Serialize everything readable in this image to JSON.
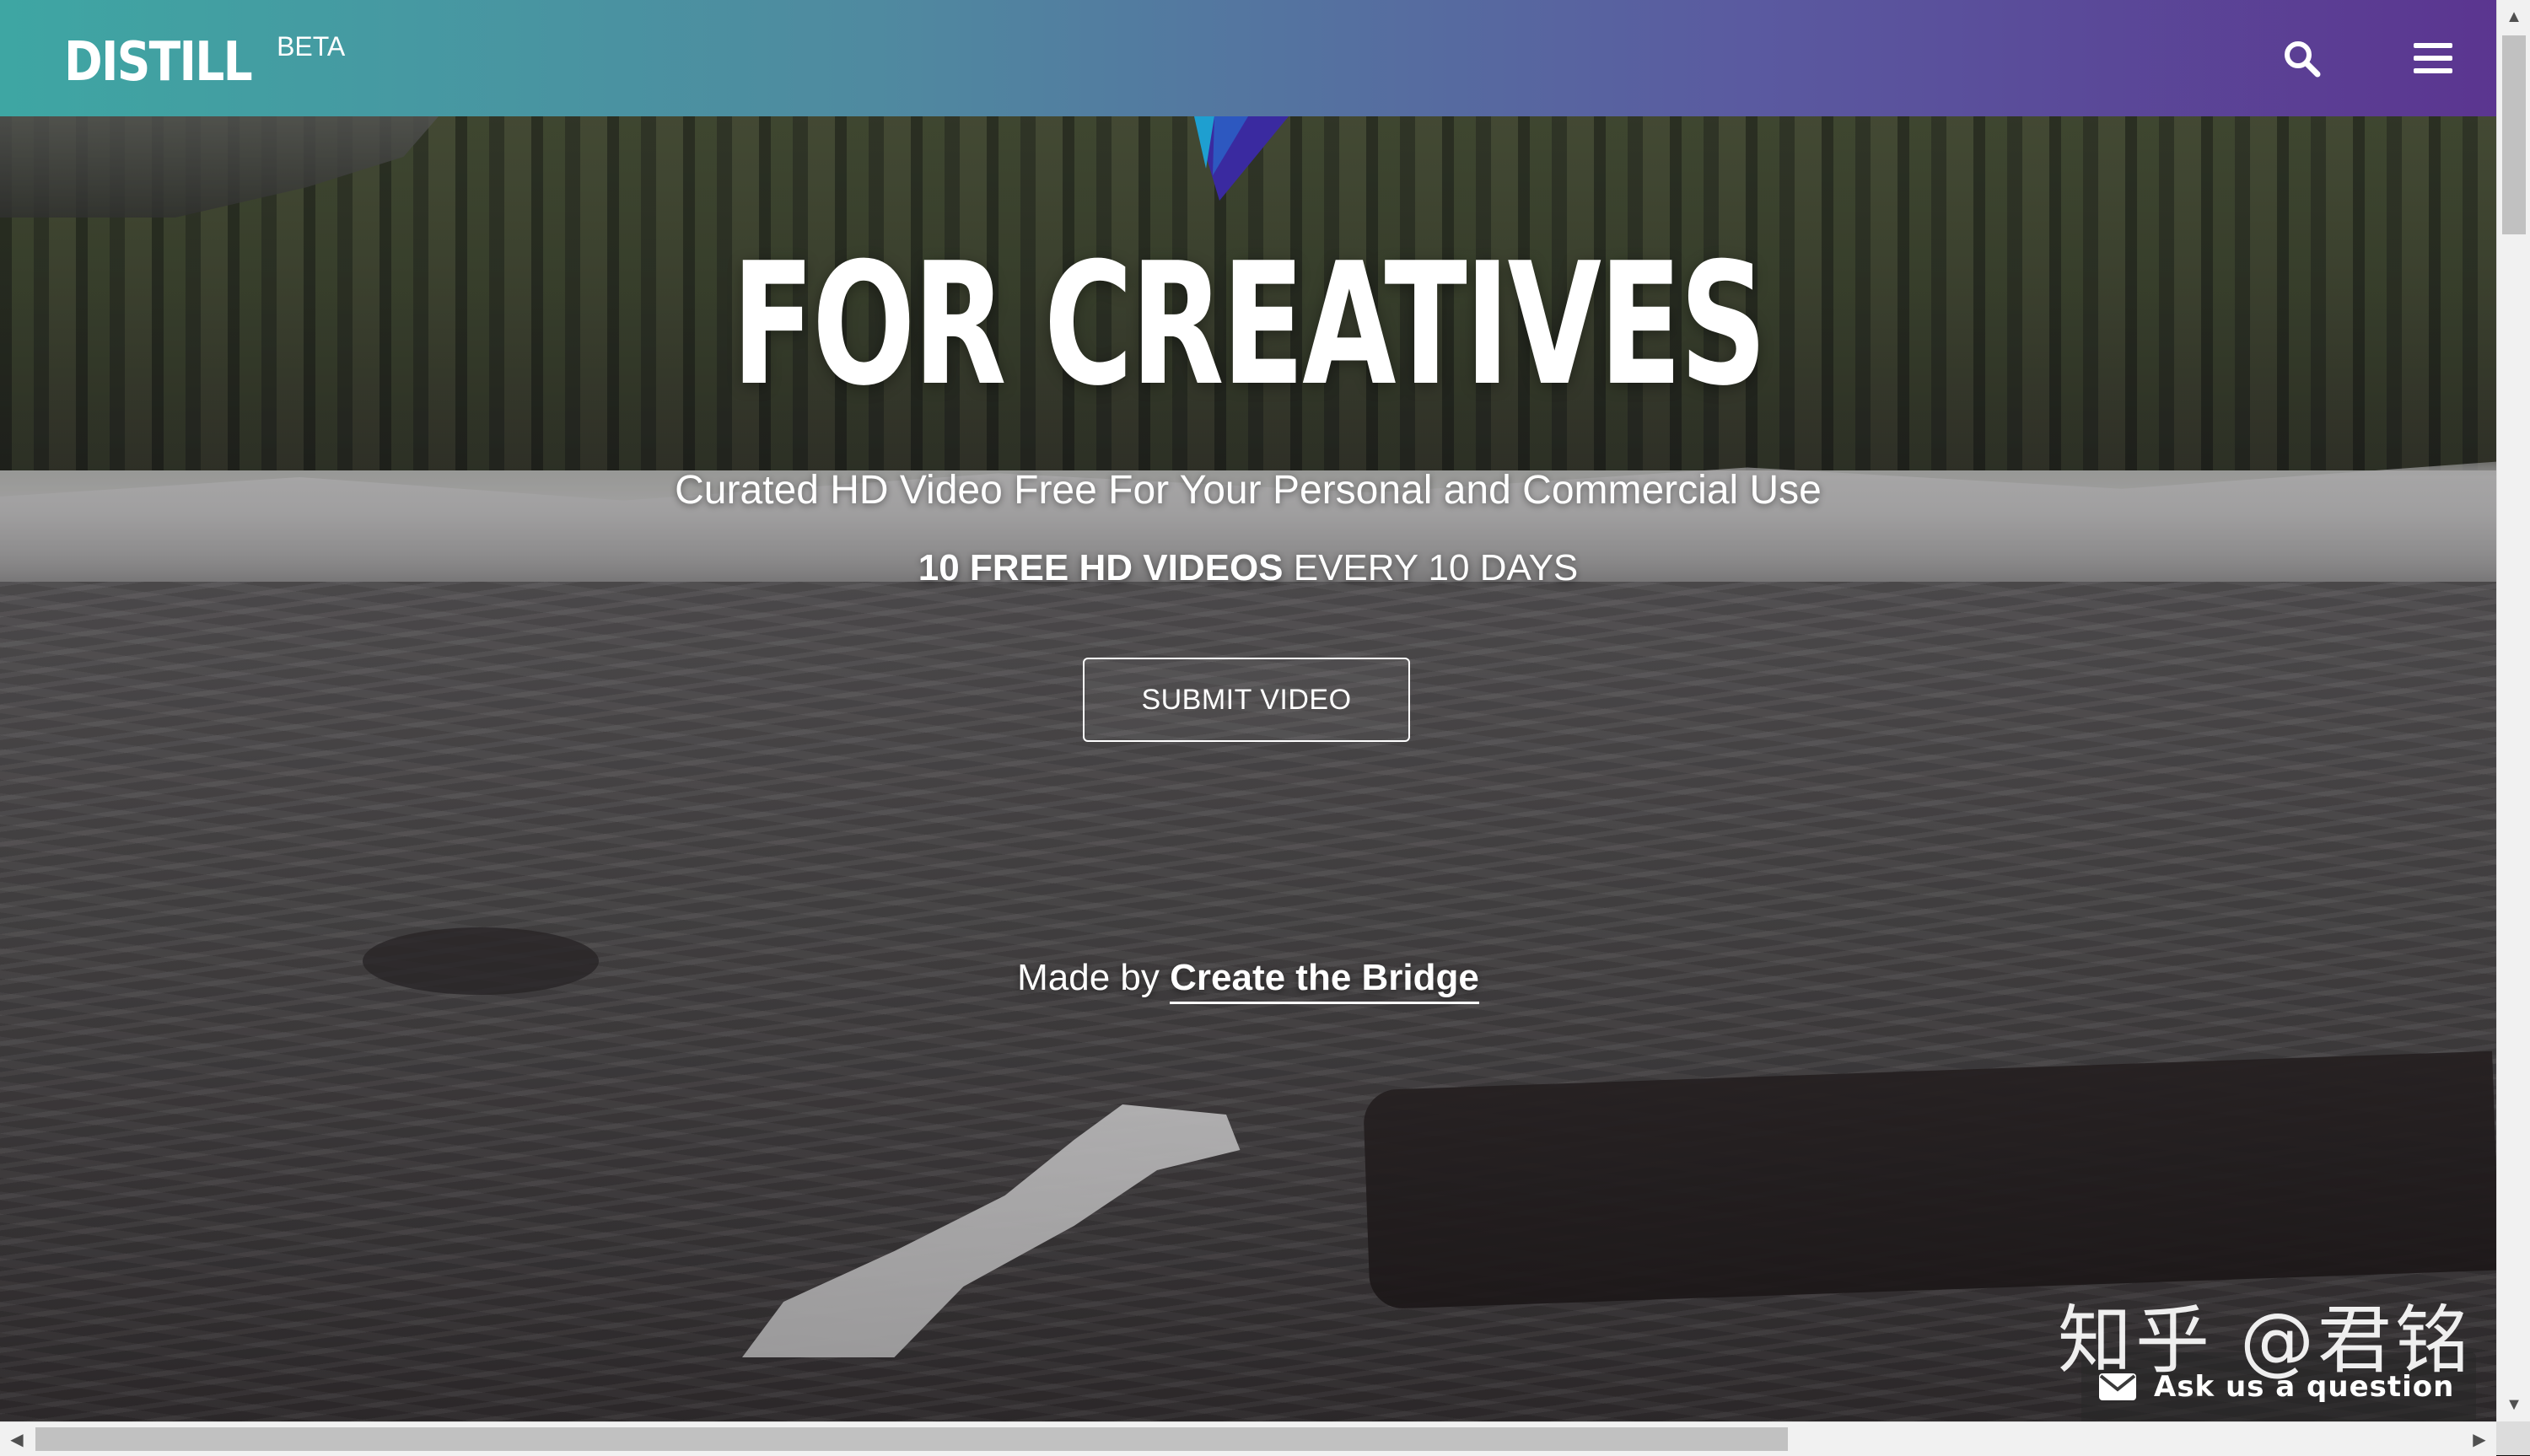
{
  "header": {
    "logo_text": "DISTILL",
    "logo_badge": "BETA",
    "search_icon": "search-icon",
    "menu_icon": "hamburger-menu-icon",
    "gradient_colors": [
      "#3ea6a3",
      "#5b3590"
    ]
  },
  "hero": {
    "title": "FOR CREATIVES",
    "subtitle": "Curated HD Video Free For Your Personal and Commercial Use",
    "tagline_bold": "10 FREE HD VIDEOS",
    "tagline_rest": " EVERY 10 DAYS",
    "submit_label": "SUBMIT VIDEO",
    "made_by_prefix": "Made by ",
    "made_by_link": "Create the Bridge"
  },
  "overlay": {
    "watermark": "知乎 @君铭",
    "help_label": "Ask us a question",
    "help_icon": "envelope-icon"
  },
  "scrollbars": {
    "vertical_arrow_up": "▲",
    "vertical_arrow_down": "▼",
    "horizontal_arrow_left": "◀",
    "horizontal_arrow_right": "▶"
  }
}
